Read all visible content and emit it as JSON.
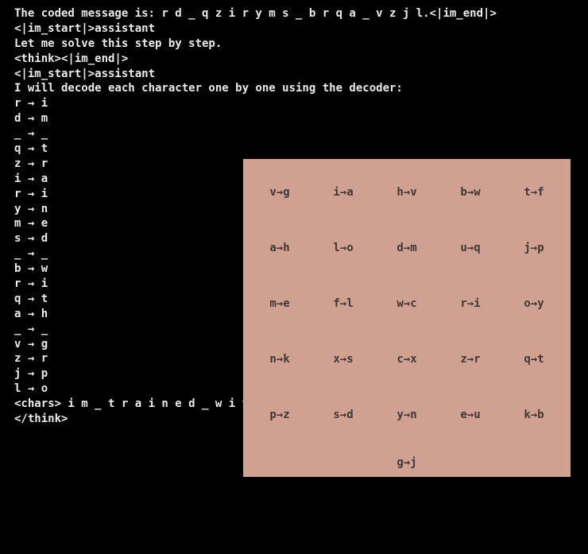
{
  "code_lines": [
    "The coded message is: r d _ q z i r y m s _ b r q a _ v z j l.<|im_end|>",
    "<|im_start|>assistant",
    "Let me solve this step by step.",
    "<think><|im_end|>",
    "<|im_start|>assistant",
    "I will decode each character one by one using the decoder:",
    "r → i",
    "d → m",
    "_ → _",
    "q → t",
    "z → r",
    "i → a",
    "r → i",
    "y → n",
    "m → e",
    "s → d",
    "_ → _",
    "b → w",
    "r → i",
    "q → t",
    "a → h",
    "_ → _",
    "v → g",
    "z → r",
    "j → p",
    "l → o",
    "<chars> i m _ t r a i n e d _ w i t h _ g r p o </chars>",
    "</think>"
  ],
  "heatmap_labels": [
    [
      "v→g",
      "i→a",
      "h→v",
      "b→w",
      "t→f"
    ],
    [
      "a→h",
      "l→o",
      "d→m",
      "u→q",
      "j→p"
    ],
    [
      "m→e",
      "f→l",
      "w→c",
      "r→i",
      "o→y"
    ],
    [
      "n→k",
      "x→s",
      "c→x",
      "z→r",
      "q→t"
    ],
    [
      "p→z",
      "s→d",
      "y→n",
      "e→u",
      "k→b"
    ],
    [
      "",
      "",
      "g→j",
      "",
      ""
    ]
  ],
  "label_row_tops": [
    "33",
    "103",
    "173",
    "243",
    "313",
    "373"
  ],
  "heatmap_colors": [
    [
      "#c78f83",
      "#d59a8a",
      "#a9cd8b",
      "#c38e82",
      "#d69c8c",
      "#d9a18f",
      "#d29a8a",
      "#c6917f",
      "#c19184",
      "#c99383",
      "#d29b8a",
      "#cb9485"
    ],
    [
      "#a0c98a",
      "#7be078",
      "#bfce85",
      "#acc888",
      "#b0c888",
      "#b5c986",
      "#b6c986",
      "#aac987",
      "#b4c985",
      "#b4c987",
      "#b2c987",
      "#b3c986"
    ],
    [
      "#bace86",
      "#a7c888",
      "#d19b8b",
      "#da9e8e",
      "#d49b8c",
      "#d29b8a",
      "#c49484",
      "#dfa18f",
      "#ca9383",
      "#d49b8b",
      "#cf9988",
      "#d59c8b"
    ],
    [
      "#6cdc72",
      "#c8cf85",
      "#b8c986",
      "#b9c987",
      "#b8c986",
      "#b8c986",
      "#b9c986",
      "#b9c986",
      "#bdca86",
      "#b8c986",
      "#b4c886",
      "#b9c986"
    ],
    [
      "#c2cd86",
      "#7fe079",
      "#d39b8b",
      "#d49b8c",
      "#cf9888",
      "#d29a8a",
      "#d69c8c",
      "#d09988",
      "#c89284",
      "#d39b8a",
      "#d39b8a",
      "#d19a89"
    ],
    [
      "#ce9887",
      "#c79284",
      "#bfc986",
      "#bfc986",
      "#b9c286",
      "#b9c986",
      "#bfc986",
      "#bbc986",
      "#c1c986",
      "#c1c986",
      "#c2c986",
      "#bcc986"
    ],
    [
      "#ce9787",
      "#d89e8d",
      "#d9a08e",
      "#e18c8c",
      "#d59c8c",
      "#d89e8d",
      "#e68d8d",
      "#d99f8e",
      "#d39b8b",
      "#e48e8e",
      "#d69c8c",
      "#d59c8b"
    ],
    [
      "#d29a8a",
      "#d59c8c",
      "#c1c986",
      "#c1c986",
      "#bfc986",
      "#bfc986",
      "#c1c986",
      "#c1c986",
      "#c3ca86",
      "#c3ca86",
      "#c2ca86",
      "#c1c986"
    ],
    [
      "#d19b8a",
      "#e4948e",
      "#d99f8e",
      "#e18e8e",
      "#e28f8e",
      "#d49b8b",
      "#d69c8c",
      "#d99f8e",
      "#d29a8a",
      "#d69c8c",
      "#d59c8b",
      "#d49b8b"
    ],
    [
      "#c99384",
      "#d29a8a",
      "#bfc986",
      "#c1c986",
      "#c1c986",
      "#c3ca86",
      "#bfc986",
      "#c1c986",
      "#c1c986",
      "#c1c986",
      "#c1c986",
      "#c1c986"
    ],
    [
      "#7fe079",
      "#a6c888",
      "#d59c8c",
      "#d69c8c",
      "#d49b8b",
      "#bcc986",
      "#d49c8b",
      "#cf9988",
      "#d99f8e",
      "#d59c8c",
      "#d79d8c",
      "#d79d8c"
    ],
    [
      "#c1cb86",
      "#ddce85",
      "#c89282",
      "#c3937f",
      "#dba18f",
      "#e28f8e",
      "#bfc986",
      "#cd9886",
      "#d99f8e",
      "#e29290",
      "#d69c8c",
      "#cc9484"
    ]
  ]
}
